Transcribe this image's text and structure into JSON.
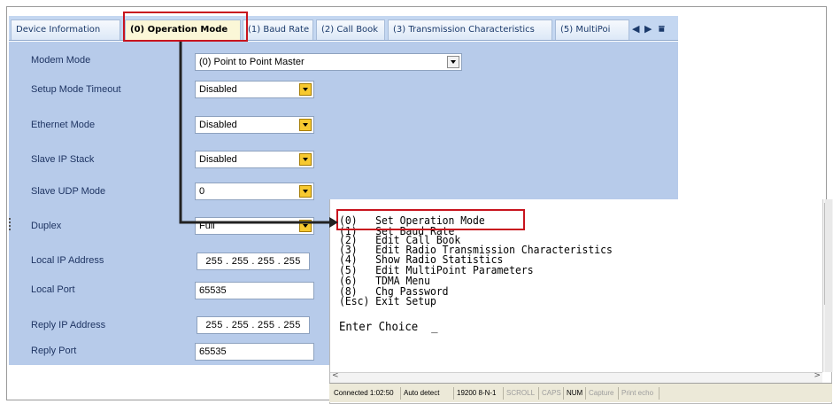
{
  "tabs": [
    {
      "label": "Device Information",
      "active": false
    },
    {
      "label": "(0) Operation Mode",
      "active": true
    },
    {
      "label": "(1) Baud Rate",
      "active": false
    },
    {
      "label": "(2) Call Book",
      "active": false
    },
    {
      "label": "(3) Transmission Characteristics",
      "active": false
    },
    {
      "label": "(5) MultiPoi",
      "active": false
    }
  ],
  "tab_nav": {
    "left_arrow": "◀",
    "right_arrow": "▶",
    "overflow": "⩸"
  },
  "form": {
    "modem_mode": {
      "label": "Modem Mode",
      "value": "(0) Point to Point Master"
    },
    "setup_mode_timeout": {
      "label": "Setup Mode Timeout",
      "value": "Disabled"
    },
    "ethernet_mode": {
      "label": "Ethernet Mode",
      "value": "Disabled"
    },
    "slave_ip_stack": {
      "label": "Slave IP Stack",
      "value": "Disabled"
    },
    "slave_udp_mode": {
      "label": "Slave UDP Mode",
      "value": "0"
    },
    "duplex": {
      "label": "Duplex",
      "value": "Full"
    },
    "local_ip_address": {
      "label": "Local IP Address",
      "value": "255 . 255 . 255 . 255"
    },
    "local_port": {
      "label": "Local Port",
      "value": "65535"
    },
    "reply_ip_address": {
      "label": "Reply IP Address",
      "value": "255 . 255 . 255 . 255"
    },
    "reply_port": {
      "label": "Reply Port",
      "value": "65535"
    }
  },
  "terminal": {
    "lines": [
      "(0)   Set Operation Mode",
      "(1)   Set Baud Rate",
      "(2)   Edit Call Book",
      "(3)   Edit Radio Transmission Characteristics",
      "(4)   Show Radio Statistics",
      "(5)   Edit MultiPoint Parameters",
      "(6)   TDMA Menu",
      "(8)   Chg Password",
      "(Esc) Exit Setup",
      "",
      "Enter Choice  _"
    ]
  },
  "statusbar": {
    "connected": "Connected 1:02:50",
    "detect": "Auto detect",
    "baud": "19200 8-N-1",
    "scroll": "SCROLL",
    "caps": "CAPS",
    "num": "NUM",
    "capture": "Capture",
    "print_echo": "Print echo"
  },
  "colors": {
    "highlight_red": "#c8141e",
    "panel_blue": "#b7cbea",
    "dropdown_yellow": "#f7c930"
  }
}
